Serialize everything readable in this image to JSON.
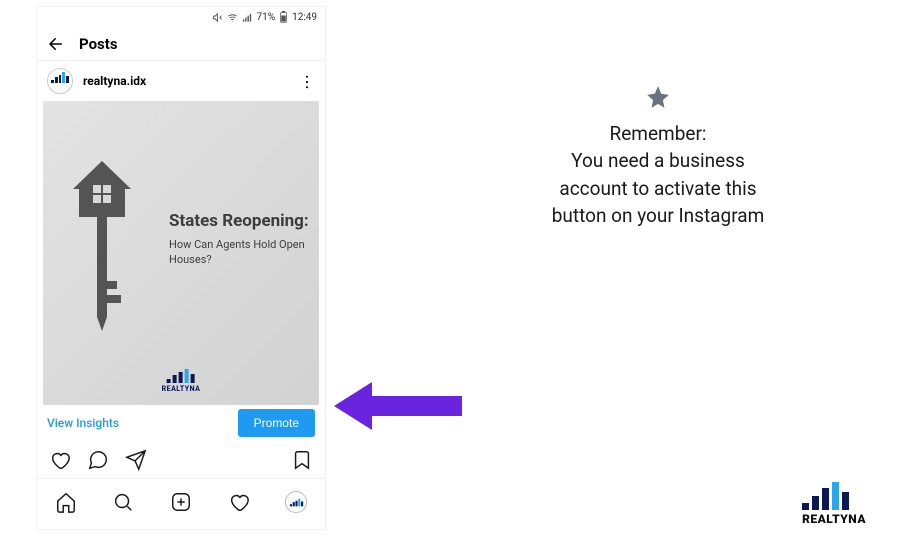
{
  "status": {
    "battery": "71%",
    "time": "12:49"
  },
  "appbar": {
    "title": "Posts"
  },
  "post": {
    "username": "realtyna.idx",
    "title": "States Reopening:",
    "subtitle": "How Can Agents Hold Open Houses?",
    "brand_small": "REALTYNA"
  },
  "actions": {
    "insights": "View Insights",
    "promote": "Promote"
  },
  "tip": {
    "heading": "Remember:",
    "body1": "You need a business",
    "body2": "account to activate this",
    "body3": "button on your Instagram"
  },
  "footer": {
    "brand": "REALTYNA"
  }
}
